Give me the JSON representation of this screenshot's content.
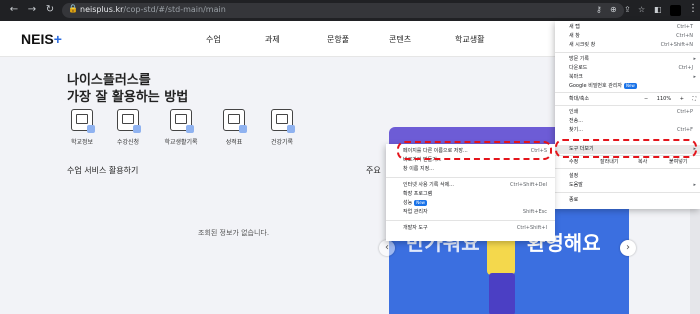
{
  "browser": {
    "url_host": "neisplus.kr",
    "url_path": "/cop-std/#/std-main/main",
    "icons": [
      "back-arrow-icon",
      "forward-arrow-icon",
      "reload-icon",
      "lock-icon",
      "key-icon",
      "zoom-icon",
      "share-icon",
      "star-icon",
      "extension-icon",
      "profile-icon",
      "more-vert-icon"
    ]
  },
  "site": {
    "logo_text": "NEIS",
    "logo_plus": "+",
    "nav": [
      "수업",
      "과제",
      "문항풀",
      "콘텐츠",
      "학교생활"
    ]
  },
  "main": {
    "hero_line1": "나이스플러스를",
    "hero_line2": "가장 잘 활용하는 방법",
    "services": [
      "학교정보",
      "수강신청",
      "학교생활기록",
      "성적표",
      "건강기록"
    ],
    "section_title": "수업 서비스 활용하기",
    "empty_message": "조회된 정보가 없습니다.",
    "right_label": "주요",
    "banner_ghost": "러스",
    "banner_hi": "반가워요",
    "banner_welcome": "환영해요"
  },
  "chrome_menu": {
    "items": [
      {
        "label": "새 탭",
        "shortcut": "Ctrl+T"
      },
      {
        "label": "새 창",
        "shortcut": "Ctrl+N"
      },
      {
        "label": "새 시크릿 창",
        "shortcut": "Ctrl+Shift+N"
      },
      {
        "label": "방문 기록",
        "shortcut": ""
      },
      {
        "label": "다운로드",
        "shortcut": "Ctrl+J"
      },
      {
        "label": "북마크",
        "shortcut": ""
      },
      {
        "label": "Google 비밀번호 관리자",
        "badge": "New"
      },
      {
        "label": "확대/축소",
        "minus": "−",
        "zoom": "110%",
        "plus": "+",
        "fullscreen": "⛶"
      },
      {
        "label": "인쇄",
        "shortcut": "Ctrl+P"
      },
      {
        "label": "전송...",
        "shortcut": ""
      },
      {
        "label": "찾기...",
        "shortcut": "Ctrl+F"
      },
      {
        "label": "도구 더보기",
        "shortcut": ""
      },
      {
        "label": "수정",
        "cut": "잘라내기",
        "copy": "복사",
        "paste": "붙여넣기"
      },
      {
        "label": "설정",
        "shortcut": ""
      },
      {
        "label": "도움말",
        "shortcut": ""
      },
      {
        "label": "종료",
        "shortcut": ""
      }
    ]
  },
  "submenu": {
    "items": [
      {
        "label": "페이지를 다른 이름으로 저장...",
        "shortcut": "Ctrl+S"
      },
      {
        "label": "바로가기 만들기...",
        "shortcut": ""
      },
      {
        "label": "창 이름 지정...",
        "shortcut": ""
      },
      {
        "label": "인터넷 사용 기록 삭제...",
        "shortcut": "Ctrl+Shift+Del"
      },
      {
        "label": "확장 프로그램",
        "shortcut": ""
      },
      {
        "label": "성능",
        "badge": "New"
      },
      {
        "label": "작업 관리자",
        "shortcut": "Shift+Esc"
      },
      {
        "label": "개발자 도구",
        "shortcut": "Ctrl+Shift+I"
      }
    ]
  },
  "colors": {
    "highlight_red": "#e4141b",
    "brand_blue": "#2b6ce0",
    "banner_blue": "#3b6fe0",
    "card_purple": "#6d5cd6"
  }
}
